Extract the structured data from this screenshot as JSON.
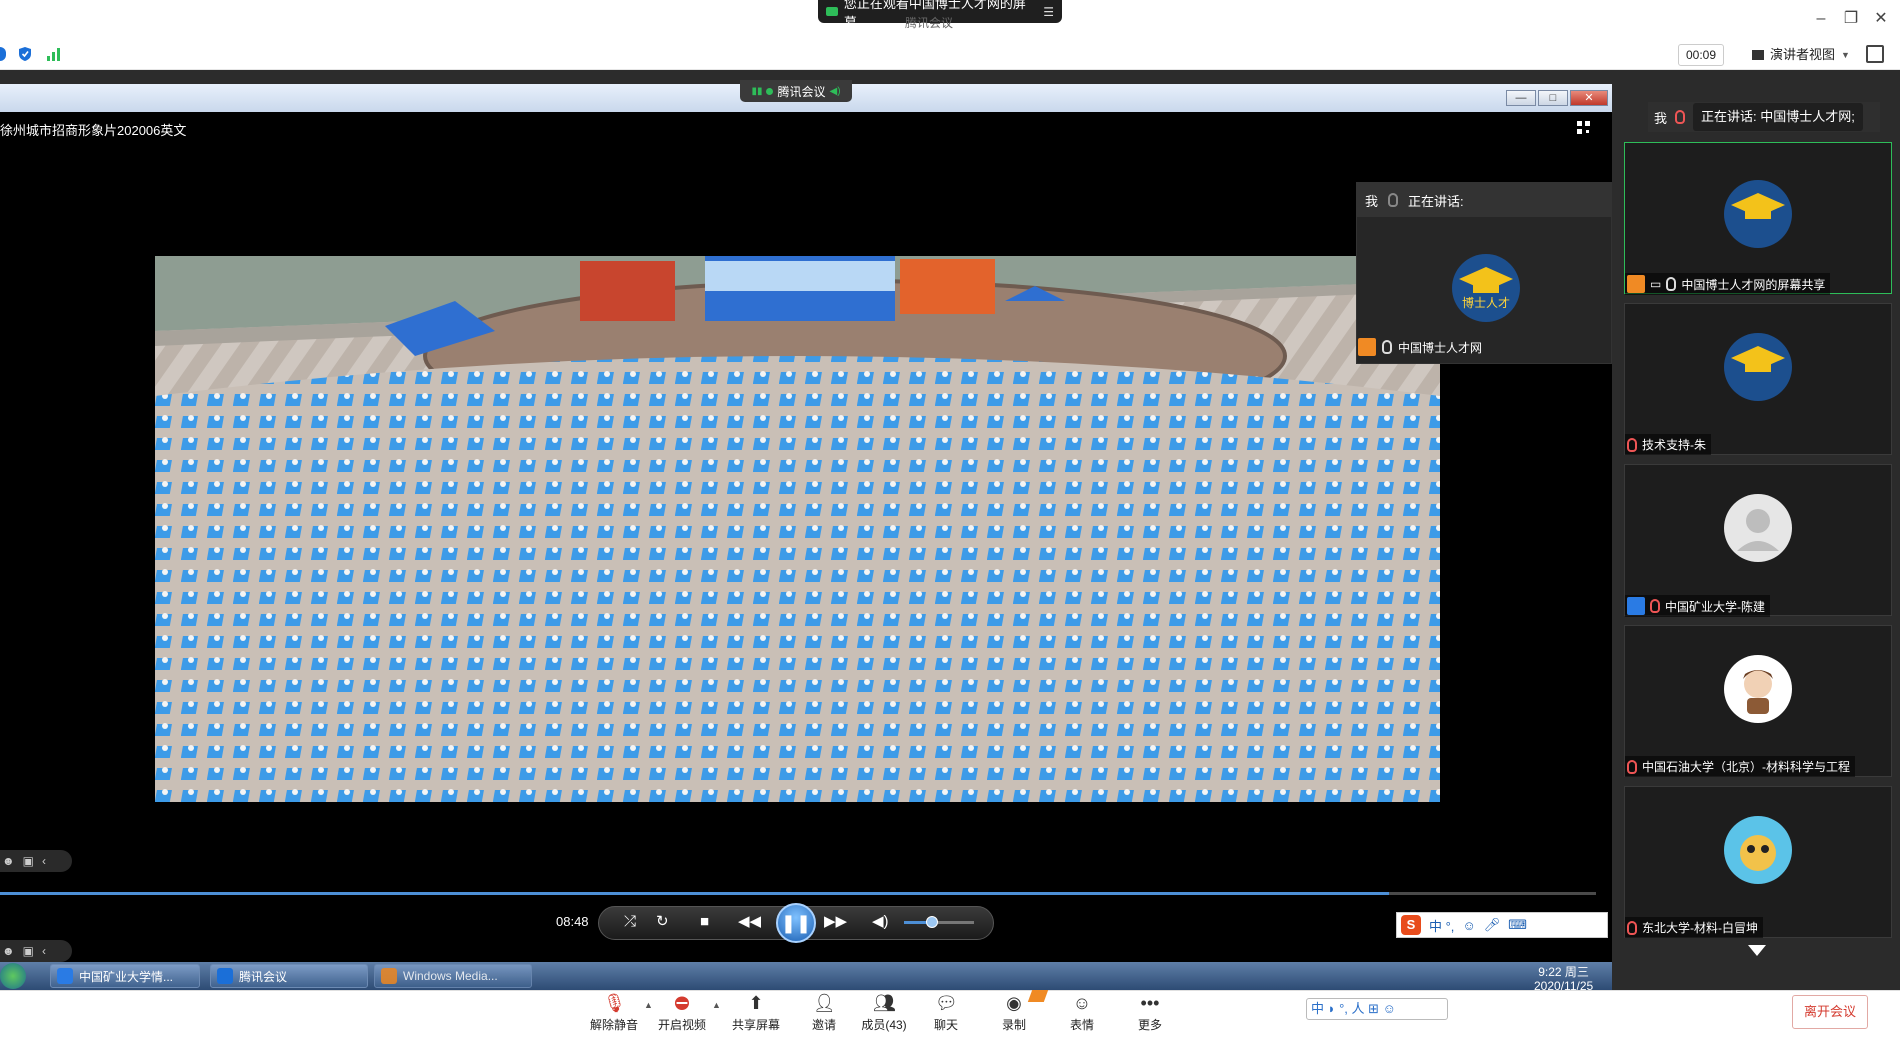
{
  "top": {
    "share_banner": "您正在观看中国博士人才网的屏幕",
    "subtitle": "腾讯会议",
    "timer": "00:09",
    "view_mode": "演讲者视图"
  },
  "shared_screen": {
    "meeting_tab": "腾讯会议",
    "video_title": "徐州城市招商形象片202006英文",
    "speaking_popup": {
      "me_label": "我",
      "speaking_label": "正在讲话:",
      "name": "中国博士人才网"
    },
    "player": {
      "time": "08:48",
      "progress": 0.87,
      "volume": 0.4
    },
    "ime_text": "中 °,",
    "taskbar": {
      "items": [
        "中国矿业大学情...",
        "腾讯会议",
        "Windows Media..."
      ],
      "time": "9:22 周三",
      "date": "2020/11/25"
    }
  },
  "sidebar": {
    "me_label": "我",
    "now_speaking": "正在讲话: 中国博士人才网;",
    "participants": [
      {
        "name": "中国博士人才网的屏幕共享",
        "avatar": "graduation-cap-logo"
      },
      {
        "name": "技术支持-朱",
        "avatar": "graduation-cap-logo"
      },
      {
        "name": "中国矿业大学-陈建",
        "avatar": "default-person"
      },
      {
        "name": "中国石油大学（北京）-材料科学与工程",
        "avatar": "cartoon-boy"
      },
      {
        "name": "东北大学-材料-白冒坤",
        "avatar": "cartoon-character"
      }
    ]
  },
  "bottombar": {
    "items": [
      "解除静音",
      "开启视频",
      "共享屏幕",
      "邀请",
      "成员(43)",
      "聊天",
      "录制",
      "表情",
      "更多"
    ],
    "ime": "中 ◗ °, 人 ⊞ ☺",
    "leave": "离开会议"
  },
  "colors": {
    "accent_green": "#2ebd59",
    "leave_red": "#d43b2f",
    "player_blue": "#4d8fd6"
  }
}
